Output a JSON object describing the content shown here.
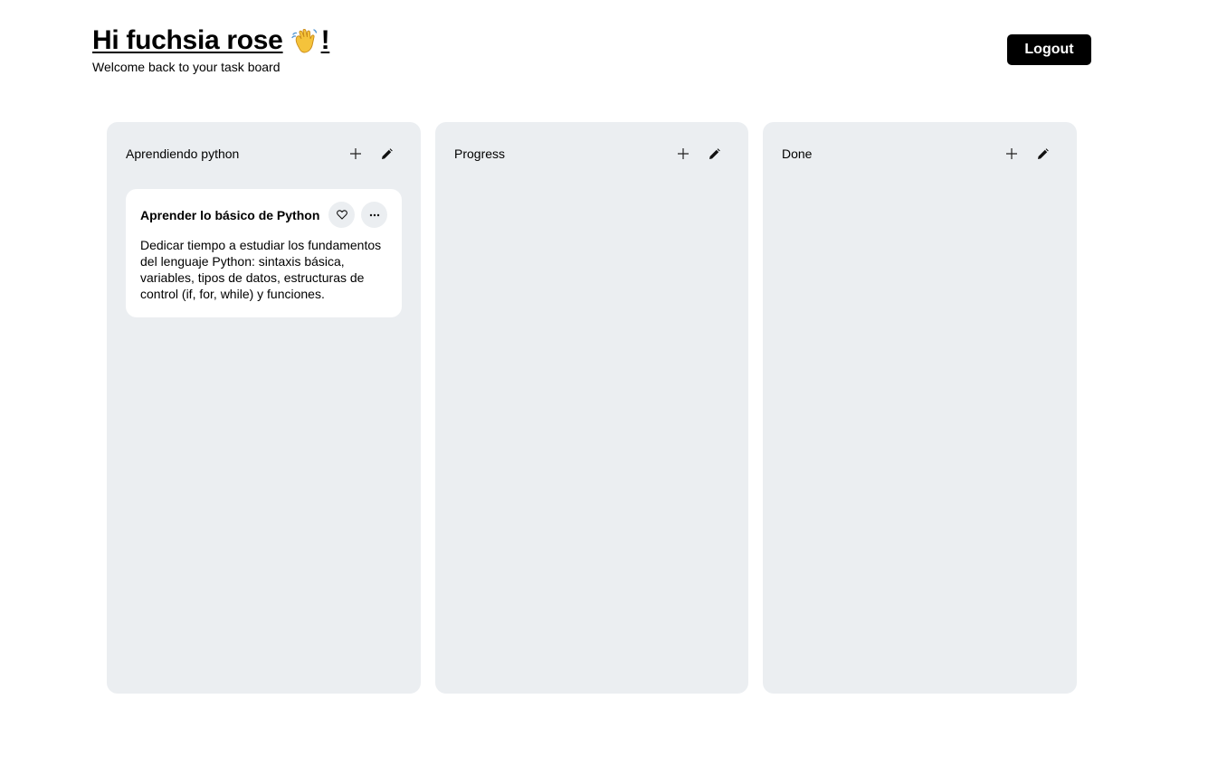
{
  "header": {
    "greeting_prefix": "Hi fuchsia rose",
    "greeting_suffix": "!",
    "emoji_icon": "waving-hand-icon",
    "subtitle": "Welcome back to your task board",
    "logout_label": "Logout"
  },
  "board": {
    "columns": [
      {
        "title": "Aprendiendo python",
        "cards": [
          {
            "title": "Aprender lo básico de Python",
            "description": "Dedicar tiempo a estudiar los fundamentos del lenguaje Python: sintaxis básica, variables, tipos de datos, estructuras de control (if, for, while) y funciones."
          }
        ]
      },
      {
        "title": "Progress",
        "cards": []
      },
      {
        "title": "Done",
        "cards": []
      }
    ]
  },
  "colors": {
    "column_bg": "#ebeef1",
    "card_bg": "#ffffff",
    "button_bg": "#000000"
  }
}
